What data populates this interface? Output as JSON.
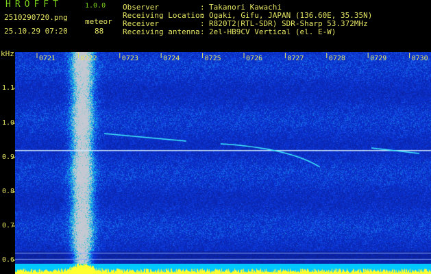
{
  "app": {
    "title": "HROFFT",
    "version": "1.0.0"
  },
  "file_name": "2510290720.png",
  "mode_label": "meteor",
  "timestamp": "25.10.29 07:20",
  "count": "88",
  "info": [
    {
      "label": "Observer",
      "value": "Takanori Kawachi"
    },
    {
      "label": "Receiving Location",
      "value": "Ogaki, Gifu, JAPAN (136.60E, 35.35N)"
    },
    {
      "label": "Receiver",
      "value": "R820T2(RTL-SDR) SDR-Sharp 53.372MHz"
    },
    {
      "label": "Receiving antenna",
      "value": "2el-HB9CV Vertical (el. E-W)"
    }
  ],
  "separator": ":",
  "spectrogram": {
    "y_unit": "kHz",
    "y_ticks": [
      "1.1",
      "1.0",
      "0.9",
      "0.8",
      "0.7",
      "0.6"
    ],
    "time_labels": [
      "0721",
      "0722",
      "0723",
      "0724",
      "0725",
      "0726",
      "0727",
      "0728",
      "0729",
      "0730"
    ],
    "colors": {
      "background": "#0a1a8c",
      "noise_bright": "#3c6cff",
      "carrier": "#cfe8ff",
      "meteor_echo": "#40f0ff",
      "text": "#e6e664",
      "amplitude_fill": "#00c8ff",
      "amplitude_peak": "#ffff30"
    }
  }
}
